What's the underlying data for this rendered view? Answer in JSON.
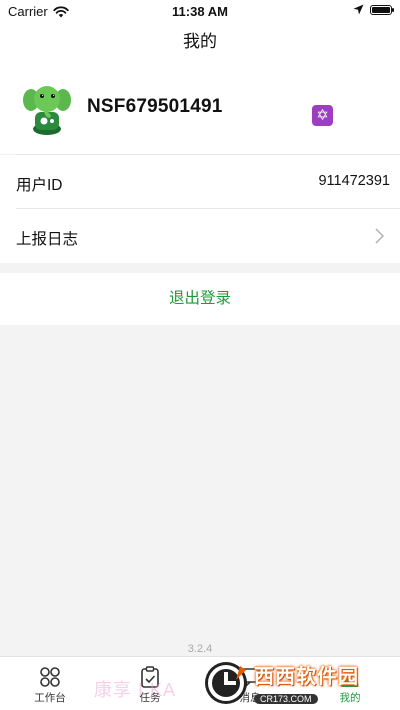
{
  "status_bar": {
    "carrier": "Carrier",
    "time": "11:38 AM"
  },
  "nav": {
    "title": "我的"
  },
  "profile": {
    "username": "NSF679501491",
    "badge_glyph": "✡"
  },
  "rows": {
    "user_id_label": "用户ID",
    "user_id_value": "911472391",
    "log_label": "上报日志"
  },
  "logout_label": "退出登录",
  "version": "3.2.4",
  "tabs": [
    {
      "label": "工作台",
      "icon": "grid-icon"
    },
    {
      "label": "任务",
      "icon": "clipboard-check-icon"
    },
    {
      "label": "消息",
      "icon": "message-icon"
    },
    {
      "label": "我的",
      "icon": "profile-icon"
    }
  ],
  "watermark": {
    "faint_text": "康享 I   KA",
    "brand": "西西软件园",
    "site": "CR173.COM"
  },
  "colors": {
    "accent": "#1f9a3b",
    "badge": "#9b3fc0",
    "background": "#f3f3f3"
  }
}
